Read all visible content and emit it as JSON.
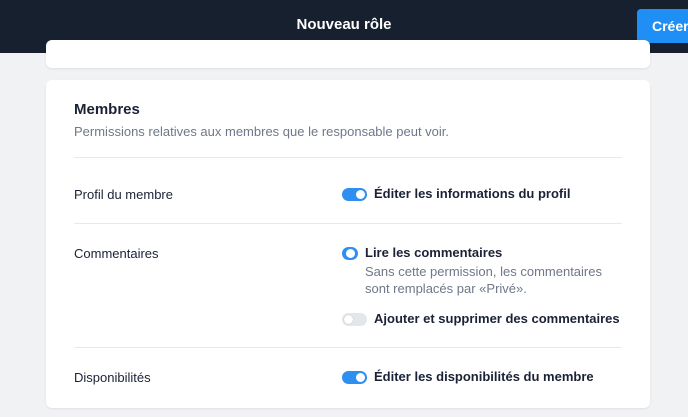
{
  "header": {
    "title": "Nouveau rôle",
    "create_label": "Créer"
  },
  "section": {
    "title": "Membres",
    "description": "Permissions relatives aux membres que le responsable peut voir."
  },
  "rows": [
    {
      "label": "Profil du membre",
      "permissions": [
        {
          "label": "Éditer les informations du profil",
          "enabled": true
        }
      ]
    },
    {
      "label": "Commentaires",
      "permissions": [
        {
          "label": "Lire les commentaires",
          "help": "Sans cette permission, les commentaires sont remplacés par «Privé».",
          "enabled": true
        },
        {
          "label": "Ajouter et supprimer des commentaires",
          "enabled": false
        }
      ]
    },
    {
      "label": "Disponibilités",
      "permissions": [
        {
          "label": "Éditer les disponibilités du membre",
          "enabled": true
        }
      ]
    }
  ],
  "colors": {
    "topbar": "#17202e",
    "accent": "#1f8ef5",
    "toggle_on": "#2f8ff0",
    "toggle_off": "#e3e6ea"
  }
}
